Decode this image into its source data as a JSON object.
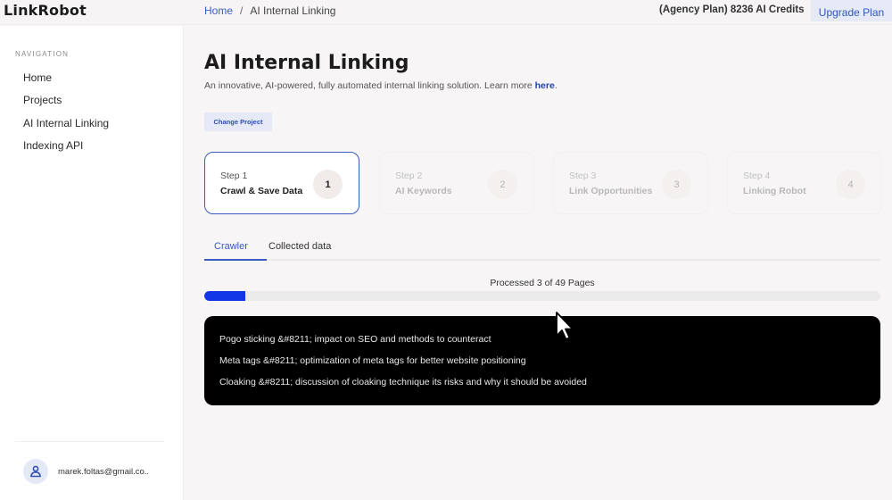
{
  "app": {
    "logo": "LinkRobot"
  },
  "header": {
    "breadcrumb": [
      {
        "label": "Home"
      },
      {
        "label": "AI Internal Linking"
      }
    ],
    "breadcrumb_separator": "/",
    "credits": "(Agency Plan) 8236 AI Credits",
    "upgrade_label": "Upgrade Plan"
  },
  "sidebar": {
    "heading": "NAVIGATION",
    "items": [
      {
        "label": "Home"
      },
      {
        "label": "Projects"
      },
      {
        "label": "AI Internal Linking"
      },
      {
        "label": "Indexing API"
      }
    ],
    "user": {
      "email": "marek.foltas@gmail.co..",
      "icon": "user-icon"
    }
  },
  "page": {
    "title": "AI Internal Linking",
    "subtitle": "An innovative, AI-powered, fully automated internal linking solution. Learn more ",
    "subtitle_link": "here",
    "subtitle_end": ".",
    "change_project_label": "Change Project"
  },
  "steps": [
    {
      "step_label": "Step 1",
      "title": "Crawl & Save Data",
      "number": "1",
      "active": true
    },
    {
      "step_label": "Step 2",
      "title": "AI Keywords",
      "number": "2",
      "active": false
    },
    {
      "step_label": "Step 3",
      "title": "Link Opportunities",
      "number": "3",
      "active": false
    },
    {
      "step_label": "Step 4",
      "title": "Linking Robot",
      "number": "4",
      "active": false
    }
  ],
  "tabs": [
    {
      "label": "Crawler",
      "active": true
    },
    {
      "label": "Collected data",
      "active": false
    }
  ],
  "crawler": {
    "progress_label": "Processed 3 of 49 Pages",
    "processed": 3,
    "total": 49,
    "accent_color": "#1237e6",
    "log_lines": [
      "Pogo sticking &#8211; impact on SEO and methods to counteract",
      "Meta tags &#8211; optimization of meta tags for better website positioning",
      "Cloaking &#8211; discussion of cloaking technique its risks and why it should be avoided"
    ]
  }
}
